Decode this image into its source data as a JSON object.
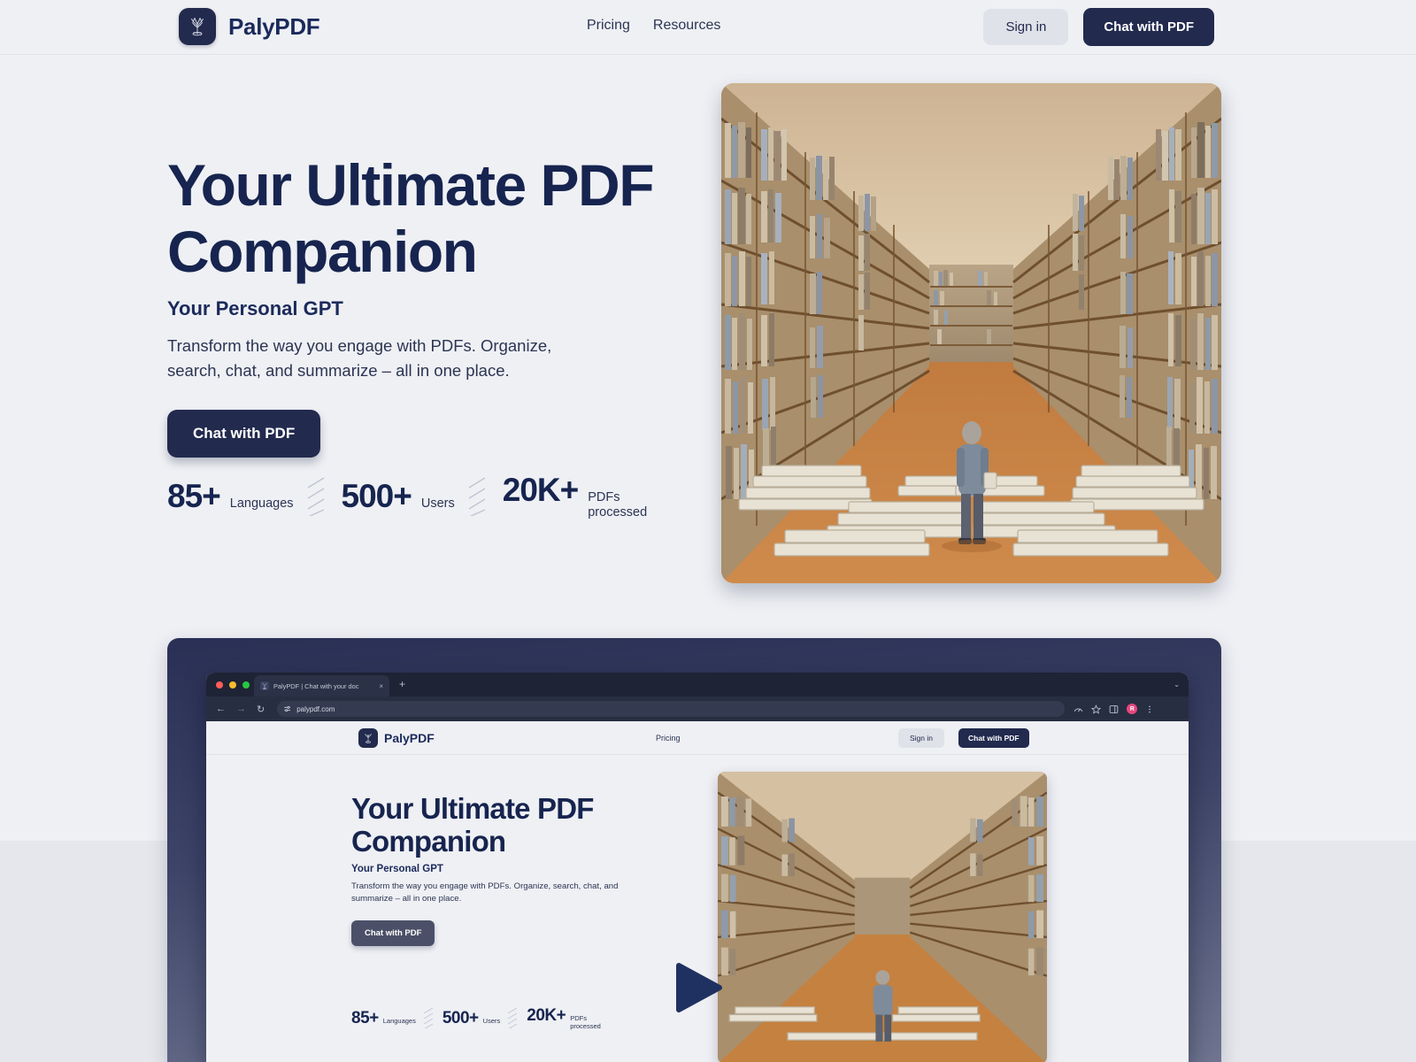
{
  "brand": {
    "name": "PalyPDF",
    "logo_icon": "tree-logo-icon"
  },
  "nav": {
    "links": [
      {
        "label": "Pricing",
        "name": "nav-link-pricing"
      },
      {
        "label": "Resources",
        "name": "nav-link-resources"
      }
    ],
    "sign_in_label": "Sign in",
    "cta_label": "Chat with PDF"
  },
  "hero": {
    "heading_line1": "Your Ultimate PDF",
    "heading_line2": "Companion",
    "subheading": "Your Personal GPT",
    "description": "Transform the way you engage with PDFs. Organize, search, chat, and summarize – all in one place.",
    "cta_label": "Chat with PDF",
    "image_alt": "library-aisle-illustration"
  },
  "stats": [
    {
      "value": "85+",
      "label": "Languages"
    },
    {
      "value": "500+",
      "label": "Users"
    },
    {
      "value": "20K+",
      "label": "PDFs processed"
    }
  ],
  "video_mockup": {
    "play_button_label": "play-video",
    "browser": {
      "tab_title": "PalyPDF | Chat with your doc",
      "tab_close_glyph": "×",
      "new_tab_glyph": "+",
      "tabbar_chevron_glyph": "⌄",
      "url": "palypdf.com",
      "nav_back_glyph": "←",
      "nav_forward_glyph": "→",
      "nav_reload_glyph": "↻",
      "site_settings_icon": "tune-sliders-icon",
      "toolbar_icons": [
        "performance-gauge-icon",
        "bookmark-star-icon",
        "side-panel-icon"
      ],
      "profile_initial": "R",
      "traffic_lights": [
        "#ff5f57",
        "#febc2e",
        "#28c840"
      ]
    },
    "page": {
      "brand_name": "PalyPDF",
      "nav_link": "Pricing",
      "sign_in_label": "Sign in",
      "cta_label": "Chat with PDF",
      "heading_line1": "Your Ultimate PDF",
      "heading_line2": "Companion",
      "subheading": "Your Personal GPT",
      "description": "Transform the way you engage with PDFs. Organize, search, chat, and summarize – all in one place.",
      "button_label": "Chat with PDF",
      "stats": [
        {
          "value": "85+",
          "label": "Languages"
        },
        {
          "value": "500+",
          "label": "Users"
        },
        {
          "value": "20K+",
          "label": "PDFs processed"
        }
      ]
    }
  },
  "colors": {
    "page_bg_top": "#eff0f4",
    "page_bg_bottom": "#e5e7ec",
    "navy": "#222a4e",
    "heading_navy": "#16244f",
    "muted_button": "#e0e2e9",
    "avatar_pink": "#e8467e"
  }
}
